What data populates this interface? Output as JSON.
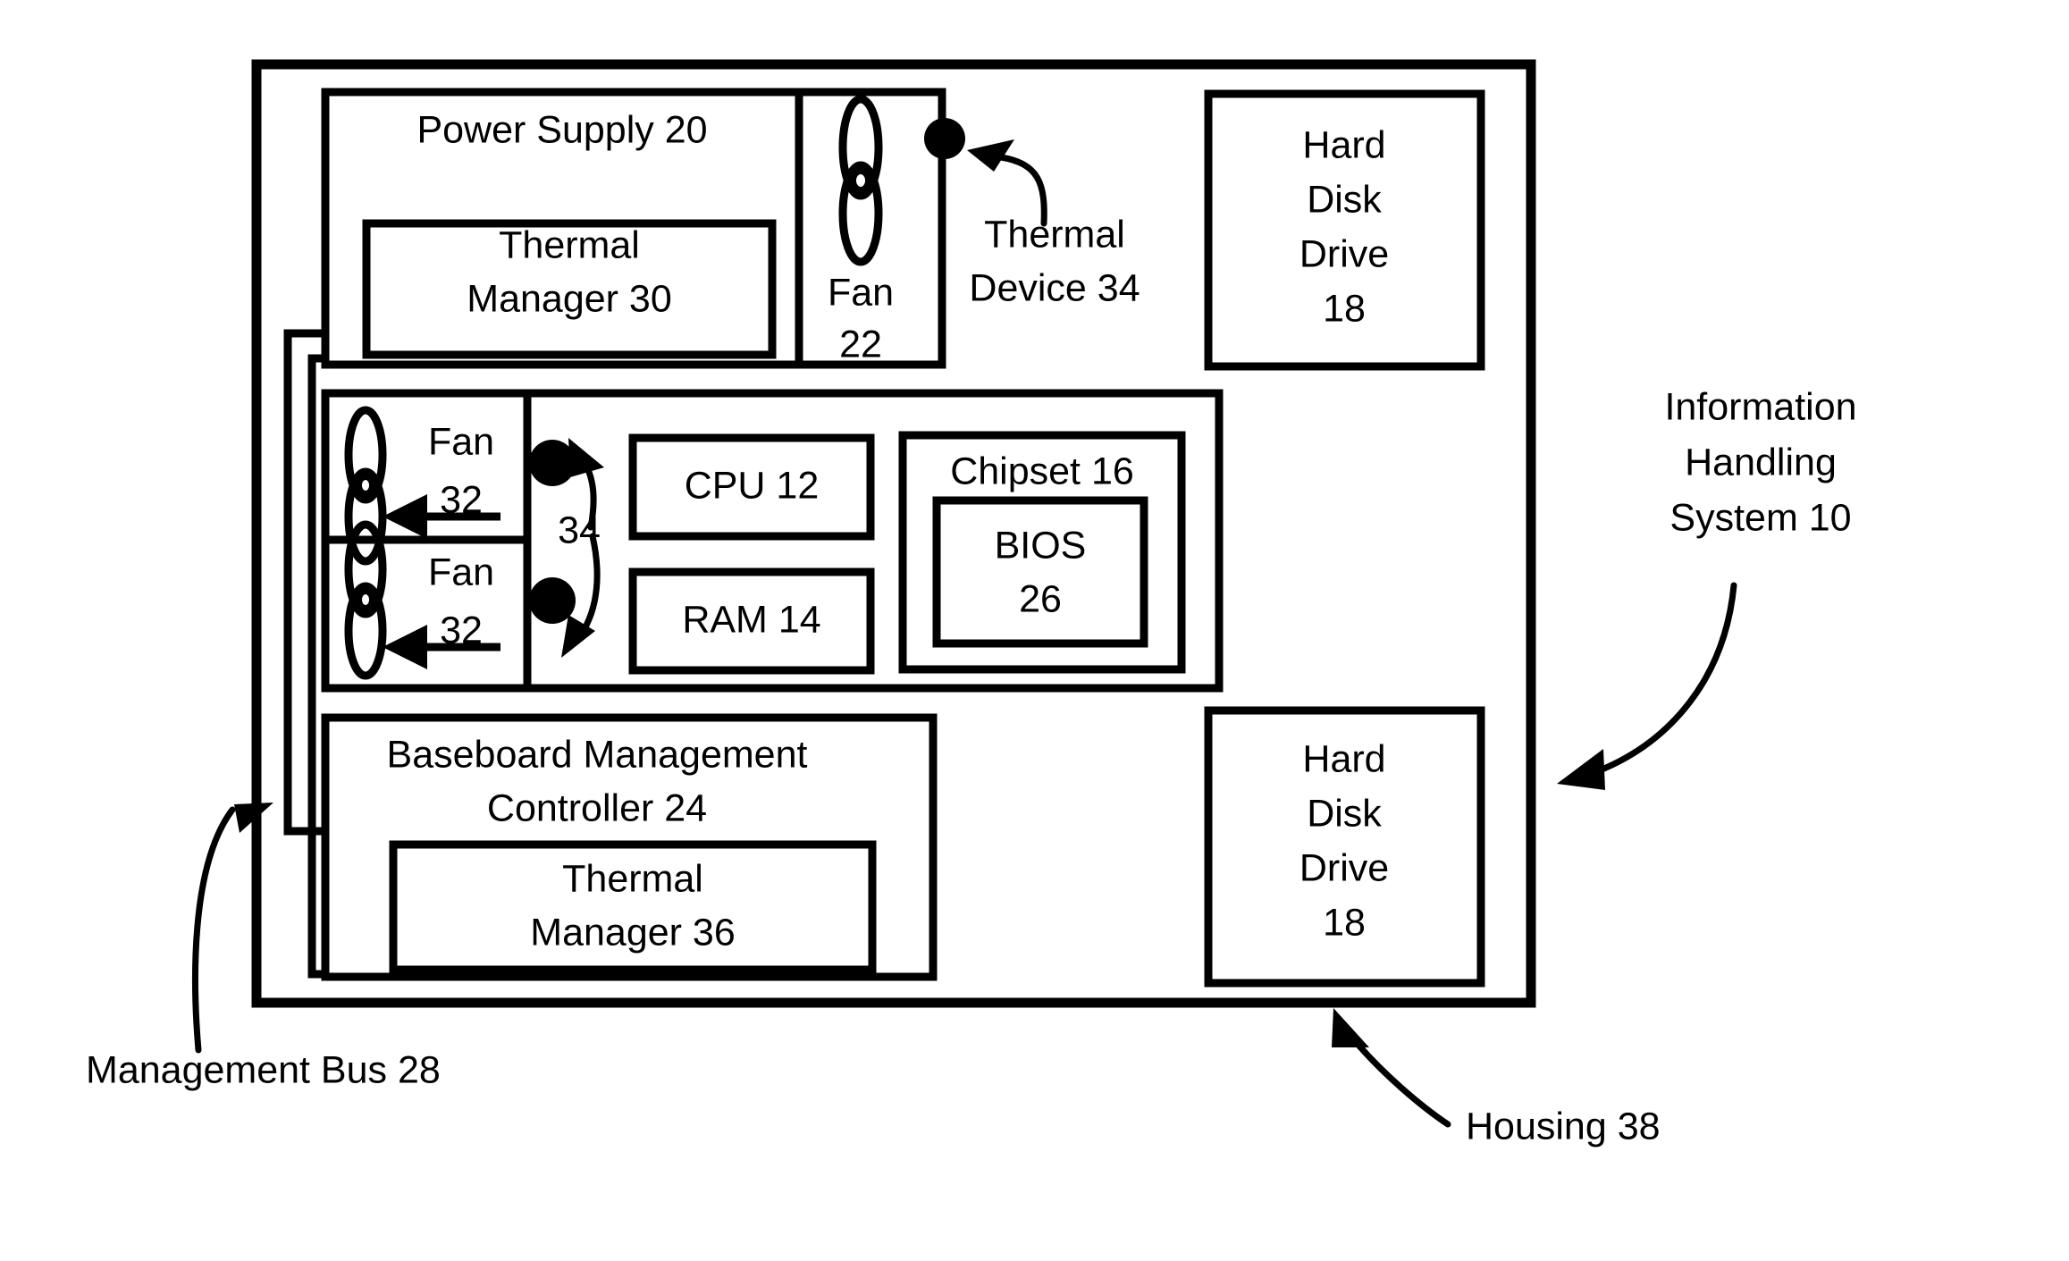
{
  "figure": {
    "title": "Information Handling System thermal management block diagram",
    "background_color": "#ffffff",
    "line_color": "#000000"
  },
  "housing": {
    "label": "Housing 38",
    "ref": "38",
    "callout_label": "Housing 38"
  },
  "system": {
    "label_line1": "Information",
    "label_line2": "Handling",
    "label_line3": "System 10",
    "ref": "10"
  },
  "management_bus": {
    "label": "Management Bus 28",
    "ref": "28"
  },
  "power_supply": {
    "label": "Power Supply 20",
    "ref": "20",
    "thermal_manager": {
      "line1": "Thermal",
      "line2": "Manager 30",
      "ref": "30"
    }
  },
  "psu_fan": {
    "label_line1": "Fan",
    "label_line2": "22",
    "ref": "22",
    "icon": "fan-propeller-icon"
  },
  "thermal_device_psu": {
    "label_line1": "Thermal",
    "label_line2": "Device 34",
    "ref": "34"
  },
  "hard_disk_drive_top": {
    "line1": "Hard",
    "line2": "Disk",
    "line3": "Drive",
    "line4": "18",
    "ref": "18"
  },
  "hard_disk_drive_bottom": {
    "line1": "Hard",
    "line2": "Disk",
    "line3": "Drive",
    "line4": "18",
    "ref": "18"
  },
  "motherboard": {
    "fans": [
      {
        "label_line1": "Fan",
        "label_line2": "32",
        "ref": "32",
        "icon": "fan-propeller-icon",
        "airflow": "left-arrow-icon"
      },
      {
        "label_line1": "Fan",
        "label_line2": "32",
        "ref": "32",
        "icon": "fan-propeller-icon",
        "airflow": "left-arrow-icon"
      }
    ],
    "thermal_devices_label": "34",
    "thermal_devices_ref": "34",
    "cpu": {
      "label": "CPU 12",
      "ref": "12"
    },
    "ram": {
      "label": "RAM 14",
      "ref": "14"
    },
    "chipset": {
      "label": "Chipset 16",
      "ref": "16",
      "bios": {
        "line1": "BIOS",
        "line2": "26",
        "ref": "26"
      }
    }
  },
  "bmc": {
    "line1": "Baseboard Management",
    "line2": "Controller 24",
    "ref": "24",
    "thermal_manager": {
      "line1": "Thermal",
      "line2": "Manager 36",
      "ref": "36"
    }
  }
}
